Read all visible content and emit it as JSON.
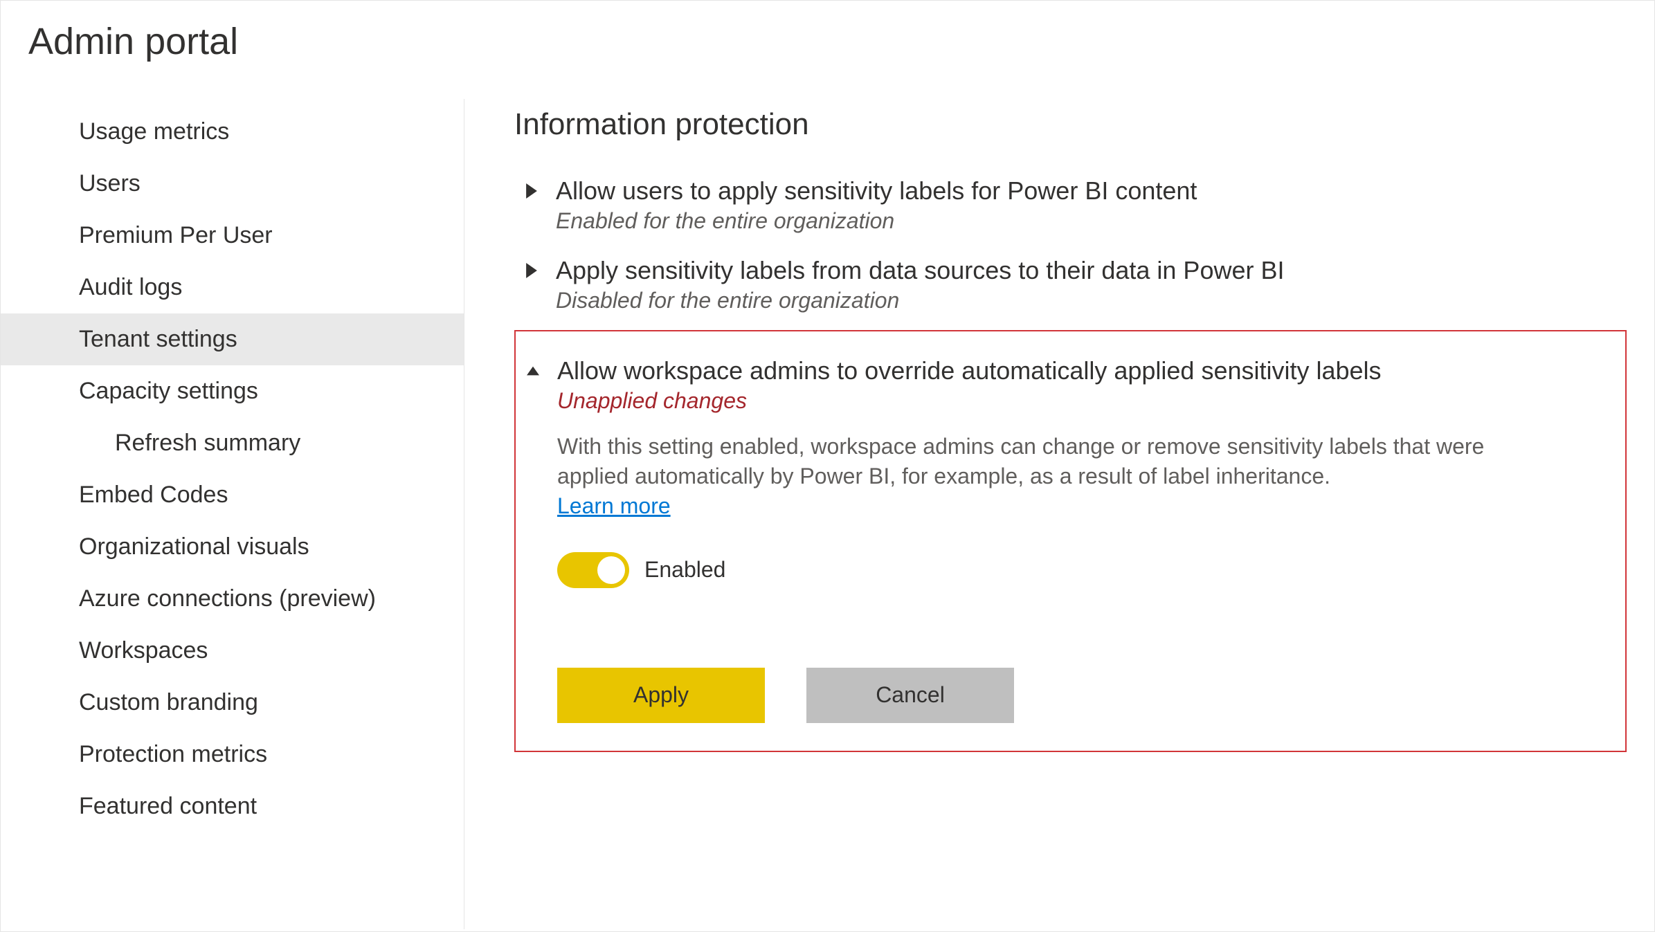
{
  "page_title": "Admin portal",
  "sidebar": {
    "items": [
      {
        "label": "Usage metrics",
        "selected": false,
        "indented": false
      },
      {
        "label": "Users",
        "selected": false,
        "indented": false
      },
      {
        "label": "Premium Per User",
        "selected": false,
        "indented": false
      },
      {
        "label": "Audit logs",
        "selected": false,
        "indented": false
      },
      {
        "label": "Tenant settings",
        "selected": true,
        "indented": false
      },
      {
        "label": "Capacity settings",
        "selected": false,
        "indented": false
      },
      {
        "label": "Refresh summary",
        "selected": false,
        "indented": true
      },
      {
        "label": "Embed Codes",
        "selected": false,
        "indented": false
      },
      {
        "label": "Organizational visuals",
        "selected": false,
        "indented": false
      },
      {
        "label": "Azure connections (preview)",
        "selected": false,
        "indented": false
      },
      {
        "label": "Workspaces",
        "selected": false,
        "indented": false
      },
      {
        "label": "Custom branding",
        "selected": false,
        "indented": false
      },
      {
        "label": "Protection metrics",
        "selected": false,
        "indented": false
      },
      {
        "label": "Featured content",
        "selected": false,
        "indented": false
      }
    ]
  },
  "main": {
    "section_title": "Information protection",
    "settings": [
      {
        "title": "Allow users to apply sensitivity labels for Power BI content",
        "status": "Enabled for the entire organization",
        "expanded": false
      },
      {
        "title": "Apply sensitivity labels from data sources to their data in Power BI",
        "status": "Disabled for the entire organization",
        "expanded": false
      },
      {
        "title": "Allow workspace admins to override automatically applied sensitivity labels",
        "status": "Unapplied changes",
        "expanded": true,
        "description": "With this setting enabled, workspace admins can change or remove sensitivity labels that were applied automatically by Power BI, for example, as a result of label inheritance.",
        "learn_more": "Learn more",
        "toggle_state": "Enabled",
        "apply_label": "Apply",
        "cancel_label": "Cancel"
      }
    ]
  }
}
